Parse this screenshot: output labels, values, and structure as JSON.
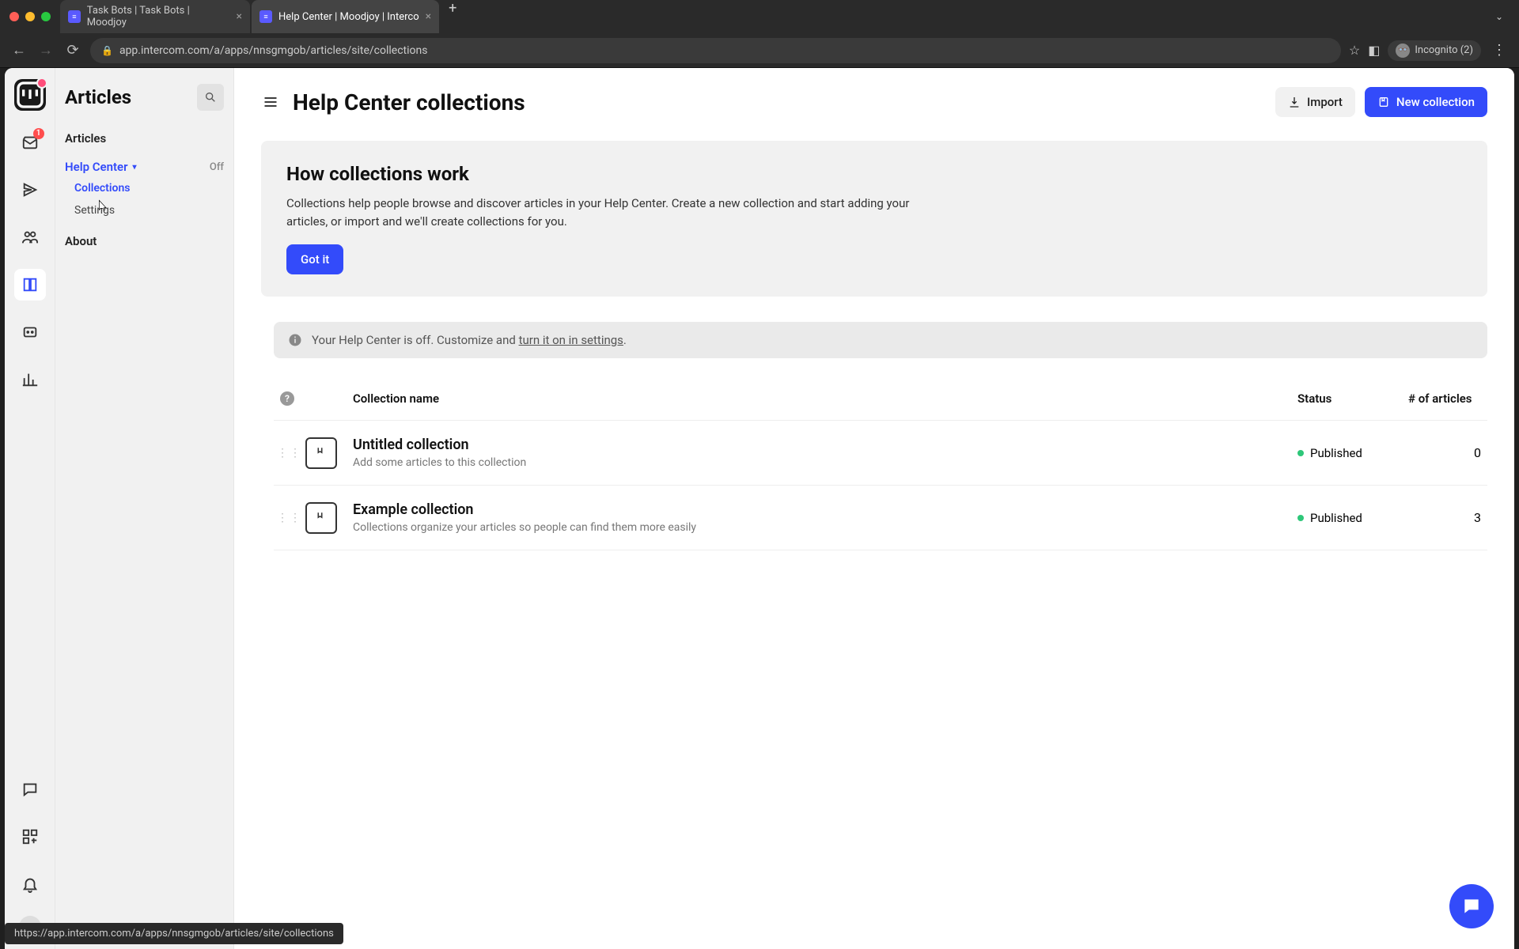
{
  "browser": {
    "tabs": [
      {
        "title": "Task Bots | Task Bots | Moodjoy"
      },
      {
        "title": "Help Center | Moodjoy | Interco"
      }
    ],
    "url": "app.intercom.com/a/apps/nnsgmgob/articles/site/collections",
    "incognito_label": "Incognito (2)"
  },
  "rail": {
    "inbox_badge": "1"
  },
  "sidebar": {
    "title": "Articles",
    "section_label": "Articles",
    "group_label": "Help Center",
    "group_status": "Off",
    "sub_items": {
      "collections": "Collections",
      "settings": "Settings"
    },
    "about": "About"
  },
  "header": {
    "page_title": "Help Center collections",
    "import": "Import",
    "new_collection": "New collection"
  },
  "callout": {
    "title": "How collections work",
    "body": "Collections help people browse and discover articles in your Help Center. Create a new collection and start adding your articles, or import and we'll create collections for you.",
    "got_it": "Got it"
  },
  "notice": {
    "prefix": "Your Help Center is off. Customize and ",
    "link": "turn it on in settings",
    "suffix": "."
  },
  "table": {
    "headers": {
      "name": "Collection name",
      "status": "Status",
      "count": "# of articles"
    },
    "rows": [
      {
        "title": "Untitled collection",
        "sub": "Add some articles to this collection",
        "status": "Published",
        "count": "0"
      },
      {
        "title": "Example collection",
        "sub": "Collections organize your articles so people can find them more easily",
        "status": "Published",
        "count": "3"
      }
    ]
  },
  "status_url": "https://app.intercom.com/a/apps/nnsgmgob/articles/site/collections"
}
